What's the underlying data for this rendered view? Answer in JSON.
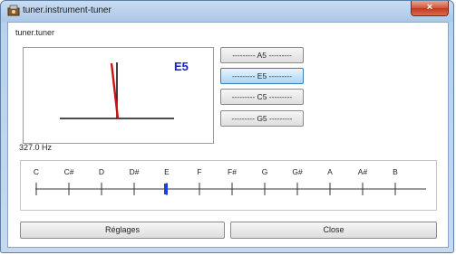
{
  "window": {
    "title": "tuner.instrument-tuner",
    "close_glyph": "×"
  },
  "panel": {
    "label": "tuner.tuner"
  },
  "meter": {
    "note": "E5"
  },
  "note_buttons": [
    {
      "label": "--------- A5 ---------",
      "selected": false
    },
    {
      "label": "--------- E5 ---------",
      "selected": true
    },
    {
      "label": "--------- C5 ---------",
      "selected": false
    },
    {
      "label": "--------- G5 ---------",
      "selected": false
    }
  ],
  "frequency": "327.0 Hz",
  "scale": {
    "notes": [
      "C",
      "C#",
      "D",
      "D#",
      "E",
      "F",
      "F#",
      "G",
      "G#",
      "A",
      "A#",
      "B"
    ],
    "indicator_note": "E",
    "indicator_color": "#1f3ee0"
  },
  "buttons": {
    "settings": "Réglages",
    "close": "Close"
  },
  "colors": {
    "needle": "#d01010",
    "note_text": "#1b1bd6"
  }
}
